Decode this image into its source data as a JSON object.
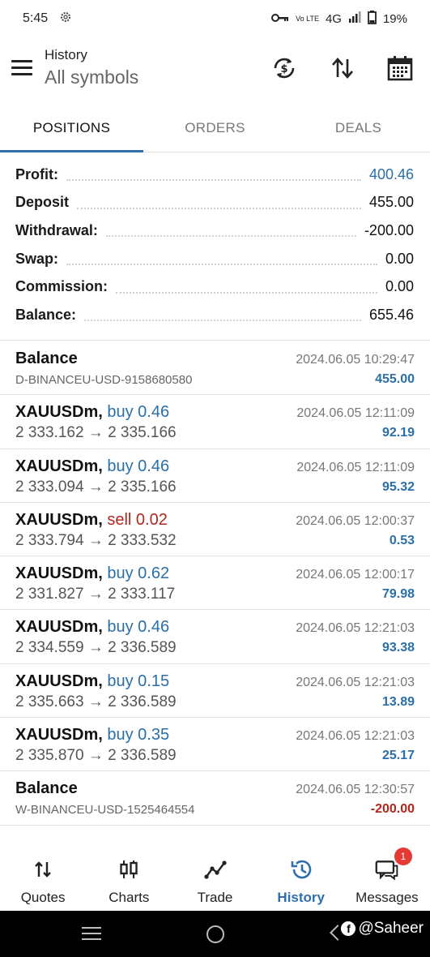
{
  "status_bar": {
    "time": "5:45",
    "network_small": "Vo LTE",
    "network": "4G",
    "battery": "19%"
  },
  "header": {
    "title": "History",
    "subtitle": "All symbols",
    "icons": [
      "sync-currency-icon",
      "sort-icon",
      "calendar-icon"
    ]
  },
  "tabs": [
    {
      "label": "POSITIONS",
      "active": true
    },
    {
      "label": "ORDERS",
      "active": false
    },
    {
      "label": "DEALS",
      "active": false
    }
  ],
  "summary": [
    {
      "label": "Profit:",
      "value": "400.46",
      "color": "#2b6fa8"
    },
    {
      "label": "Deposit",
      "value": "455.00"
    },
    {
      "label": "Withdrawal:",
      "value": "-200.00"
    },
    {
      "label": "Swap:",
      "value": "0.00"
    },
    {
      "label": "Commission:",
      "value": "0.00"
    },
    {
      "label": "Balance:",
      "value": "655.46"
    }
  ],
  "history": [
    {
      "type": "balance",
      "title": "Balance",
      "sub": "D-BINANCEU-USD-9158680580",
      "time": "2024.06.05 10:29:47",
      "amount": "455.00",
      "sign": "pos"
    },
    {
      "type": "trade",
      "symbol": "XAUUSDm,",
      "action": "buy 0.46",
      "side": "buy",
      "sub": "2 333.162 → 2 335.166",
      "time": "2024.06.05 12:11:09",
      "amount": "92.19",
      "sign": "pos"
    },
    {
      "type": "trade",
      "symbol": "XAUUSDm,",
      "action": "buy 0.46",
      "side": "buy",
      "sub": "2 333.094 → 2 335.166",
      "time": "2024.06.05 12:11:09",
      "amount": "95.32",
      "sign": "pos"
    },
    {
      "type": "trade",
      "symbol": "XAUUSDm,",
      "action": "sell 0.02",
      "side": "sell",
      "sub": "2 333.794 → 2 333.532",
      "time": "2024.06.05 12:00:37",
      "amount": "0.53",
      "sign": "pos"
    },
    {
      "type": "trade",
      "symbol": "XAUUSDm,",
      "action": "buy 0.62",
      "side": "buy",
      "sub": "2 331.827 → 2 333.117",
      "time": "2024.06.05 12:00:17",
      "amount": "79.98",
      "sign": "pos"
    },
    {
      "type": "trade",
      "symbol": "XAUUSDm,",
      "action": "buy 0.46",
      "side": "buy",
      "sub": "2 334.559 → 2 336.589",
      "time": "2024.06.05 12:21:03",
      "amount": "93.38",
      "sign": "pos"
    },
    {
      "type": "trade",
      "symbol": "XAUUSDm,",
      "action": "buy 0.15",
      "side": "buy",
      "sub": "2 335.663 → 2 336.589",
      "time": "2024.06.05 12:21:03",
      "amount": "13.89",
      "sign": "pos"
    },
    {
      "type": "trade",
      "symbol": "XAUUSDm,",
      "action": "buy 0.35",
      "side": "buy",
      "sub": "2 335.870 → 2 336.589",
      "time": "2024.06.05 12:21:03",
      "amount": "25.17",
      "sign": "pos"
    },
    {
      "type": "balance",
      "title": "Balance",
      "sub": "W-BINANCEU-USD-1525464554",
      "time": "2024.06.05 12:30:57",
      "amount": "-200.00",
      "sign": "neg"
    }
  ],
  "bottom_nav": [
    {
      "label": "Quotes",
      "icon": "quotes-icon",
      "active": false
    },
    {
      "label": "Charts",
      "icon": "charts-icon",
      "active": false
    },
    {
      "label": "Trade",
      "icon": "trade-icon",
      "active": false
    },
    {
      "label": "History",
      "icon": "history-icon",
      "active": true
    },
    {
      "label": "Messages",
      "icon": "messages-icon",
      "active": false,
      "badge": "1"
    }
  ],
  "watermark": "@Saheer",
  "colors": {
    "accent": "#2f6fad",
    "buy": "#2b6fa8",
    "sell": "#b3261e"
  }
}
